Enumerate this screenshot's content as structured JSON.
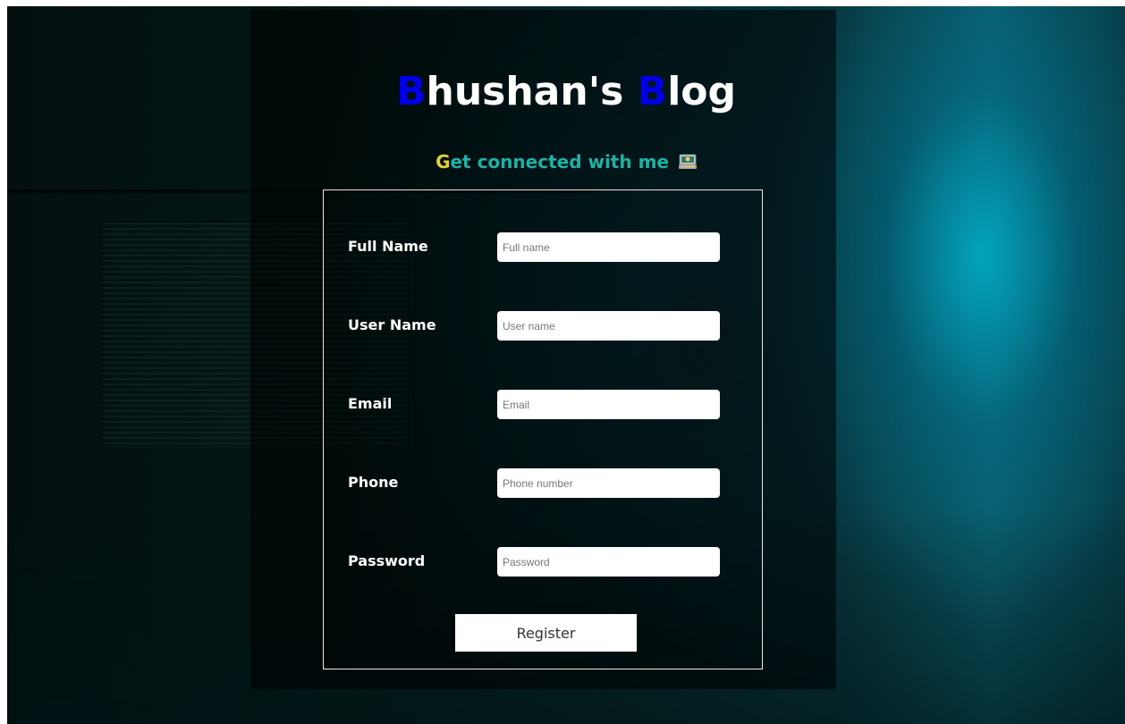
{
  "header": {
    "title_initial_1": "B",
    "title_rest_1": "hushan's ",
    "title_initial_2": "B",
    "title_rest_2": "log",
    "subtitle_initial": "G",
    "subtitle_rest": "et connected with me",
    "subtitle_icon": "technologist-emoji-icon"
  },
  "form": {
    "fields": [
      {
        "label": "Full Name",
        "placeholder": "Full name",
        "value": ""
      },
      {
        "label": "User Name",
        "placeholder": "User name",
        "value": ""
      },
      {
        "label": "Email",
        "placeholder": "Email",
        "value": ""
      },
      {
        "label": "Phone",
        "placeholder": "Phone number",
        "value": ""
      },
      {
        "label": "Password",
        "placeholder": "Password",
        "value": ""
      }
    ],
    "submit_label": "Register"
  },
  "colors": {
    "title_initial": "#0000e6",
    "title_text": "#ffffff",
    "subtitle_initial": "#e0d23a",
    "subtitle_text": "#1fb1a6",
    "form_border": "#e8e8e8"
  }
}
